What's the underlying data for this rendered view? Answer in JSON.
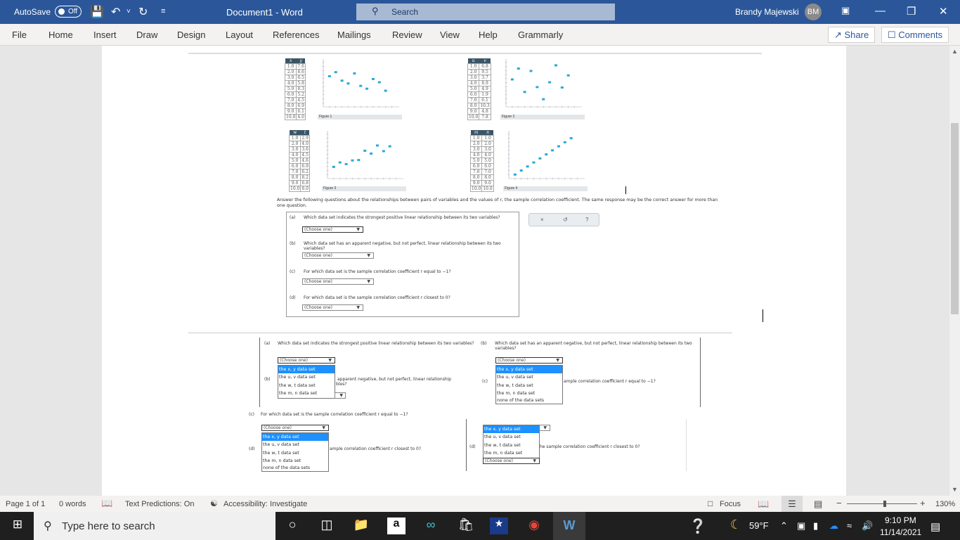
{
  "titlebar": {
    "autosave_label": "AutoSave",
    "autosave_state": "Off",
    "doc_title": "Document1  -  Word",
    "search_placeholder": "Search",
    "user_name": "Brandy Majewski",
    "user_initials": "BM"
  },
  "ribbon": {
    "tabs": [
      "File",
      "Home",
      "Insert",
      "Draw",
      "Design",
      "Layout",
      "References",
      "Mailings",
      "Review",
      "View",
      "Help",
      "Grammarly"
    ],
    "share_label": "Share",
    "comments_label": "Comments"
  },
  "document": {
    "figures": [
      {
        "label": "Figure 1",
        "xvar": "x",
        "yvar": "y",
        "x": [
          1.0,
          2.0,
          3.0,
          4.0,
          5.0,
          6.0,
          7.0,
          8.0,
          9.0,
          10.0
        ],
        "y": [
          7.6,
          8.6,
          6.5,
          5.8,
          8.3,
          5.2,
          4.5,
          6.9,
          6.1,
          4.0
        ]
      },
      {
        "label": "Figure 2",
        "xvar": "u",
        "yvar": "v",
        "x": [
          1.0,
          2.0,
          3.0,
          4.0,
          5.0,
          6.0,
          7.0,
          8.0,
          9.0,
          10.0
        ],
        "y": [
          6.8,
          9.5,
          3.7,
          8.9,
          4.9,
          1.9,
          6.1,
          10.3,
          4.8,
          7.8
        ]
      },
      {
        "label": "Figure 3",
        "xvar": "w",
        "yvar": "t",
        "x": [
          1.0,
          2.0,
          3.0,
          4.0,
          5.0,
          6.0,
          7.0,
          8.0,
          9.0,
          10.0
        ],
        "y": [
          2.9,
          4.0,
          3.6,
          4.5,
          4.6,
          6.9,
          6.2,
          8.2,
          6.8,
          8.0
        ]
      },
      {
        "label": "Figure 4",
        "xvar": "m",
        "yvar": "n",
        "x": [
          1.0,
          2.0,
          3.0,
          4.0,
          5.0,
          6.0,
          7.0,
          8.0,
          9.0,
          10.0
        ],
        "y": [
          1.0,
          2.0,
          3.0,
          4.0,
          5.0,
          6.0,
          7.0,
          8.0,
          9.0,
          10.0
        ]
      }
    ],
    "intro": "Answer the following questions about the relationships between pairs of variables and the values of r, the sample correlation coefficient. The same response may be the correct answer for more than one question.",
    "questions": [
      {
        "letter": "(a)",
        "text": "Which data set indicates the strongest positive linear relationship between its two variables?"
      },
      {
        "letter": "(b)",
        "text": "Which data set has an apparent negative, but not perfect, linear relationship between its two variables?"
      },
      {
        "letter": "(c)",
        "text": "For which data set is the sample correlation coefficient r equal to −1?"
      },
      {
        "letter": "(d)",
        "text": "For which data set is the sample correlation coefficient r closest to 0?"
      }
    ],
    "choose_placeholder": "(Choose one)",
    "options": [
      "the x, y data set",
      "the u, v data set",
      "the w, t data set",
      "the m, n data set",
      "none of the data sets"
    ],
    "fragments": {
      "b_partial": "apparent negative, but not perfect, linear relationship",
      "b_partial2": "bles?",
      "c_partial": "ample correlation coefficient r equal to −1?",
      "d_partial": "ample correlation coefficient r closest to 0?",
      "d_partial2": "he sample correlation coefficient r closest to 0?"
    },
    "toolbox": {
      "clear": "×",
      "undo": "↺",
      "help": "?"
    }
  },
  "statusbar": {
    "page": "Page 1 of 1",
    "words": "0 words",
    "text_predictions": "Text Predictions: On",
    "accessibility": "Accessibility: Investigate",
    "focus": "Focus",
    "zoom": "130%"
  },
  "taskbar": {
    "search_placeholder": "Type here to search",
    "weather": "59°F",
    "time": "9:10 PM",
    "date": "11/14/2021"
  }
}
